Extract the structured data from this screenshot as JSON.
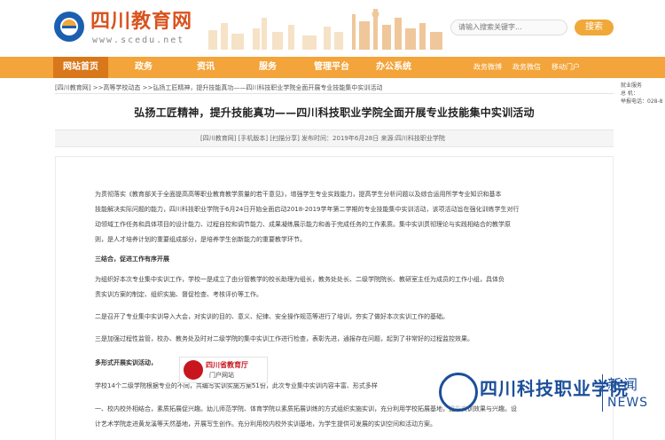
{
  "header": {
    "site_name": "四川教育网",
    "url": "www.scedu.net",
    "search_placeholder": "请输入搜索关键字...",
    "search_button": "搜索"
  },
  "nav": {
    "items": [
      "网站首页",
      "政务",
      "资讯",
      "服务",
      "管理平台",
      "办公系统"
    ],
    "sub_items": [
      "政务微博",
      "政务微信",
      "移动门户"
    ],
    "accent": "#f3a43a"
  },
  "side_panel": {
    "lines": [
      "就业服务",
      "总 机：",
      "举报电话：028-8"
    ]
  },
  "breadcrumb": {
    "items": [
      "[四川教育网]",
      ">>高等学校动态",
      ">>弘扬工匠精神，提升技能真功——四川科技职业学院全面开展专业技能集中实训活动"
    ]
  },
  "article": {
    "title": "弘扬工匠精神，提升技能真功——四川科技职业学院全面开展专业技能集中实训活动",
    "meta": "[四川教育网]  [手机版本]  [扫描分享]  发布时间：2019年6月28日  来源:四川科技职业学院",
    "paragraphs": [
      "为贯彻落实《教育部关于全面提高高等职业教育教学质量的若干意见》，增强学生专业实践能力，提高学生分析问题以及综合运用所学专业知识和基本",
      "技能解决实际问题的能力，四川科技职业学院于6月24日开始全面启动2018-2019学年第二学期的专业技能集中实训活动，该项活动旨在强化训练学生对行",
      "动领域工作任务和具体项目的设计能力、过程自控和调节能力、成果凝练展示能力和善于完成任务的工作素质。集中实训贯彻理论与实践相结合的教学原",
      "则，是人才培养计划的重要组成部分，是培养学生创新能力的重要教学环节。",
      "三结合，促进工作有序开展",
      "为组织好本次专业集中实训工作，学校一是成立了由分管教学的校长助理为组长，教务处处长、二级学院院长、教研室主任为成员的工作小组，具体负",
      "责实训方案的制定、组织实施、督促检查、考核评价等工作。",
      "二是召开了专业集中实训导入大会，对实训的目的、意义、纪律、安全操作规范等进行了培训，夯实了做好本次实训工作的基础。",
      "三是加强过程性监管，校办、教务处及时对二级学院的集中实训工作进行检查，表彰先进，通报存在问题，起到了非常好的过程监控效果。",
      "多形式开展实训活动，",
      "学校14个二级学院根据专业的不同，共编写实训实施方案51份，此次专业集中实训内容丰富、形式多样",
      "一、校内校外相结合，素质拓展促兴趣。幼儿师范学院、体育学院以素质拓展训练的方式组织实施实训，充分利用学校拓展基地，提升实训效果与兴趣。设",
      "计艺术学院走进黄龙溪等天然基地，开展写生创作。充分利用校内校外实训基地，为学生提供可发展的实训空间和活动方案。"
    ]
  },
  "badge": {
    "line1": "四川省教育厅",
    "line2": "门户网站"
  },
  "watermark": {
    "name": "四川科技职业学院",
    "news_cn": "新闻",
    "news_en": "NEWS"
  }
}
